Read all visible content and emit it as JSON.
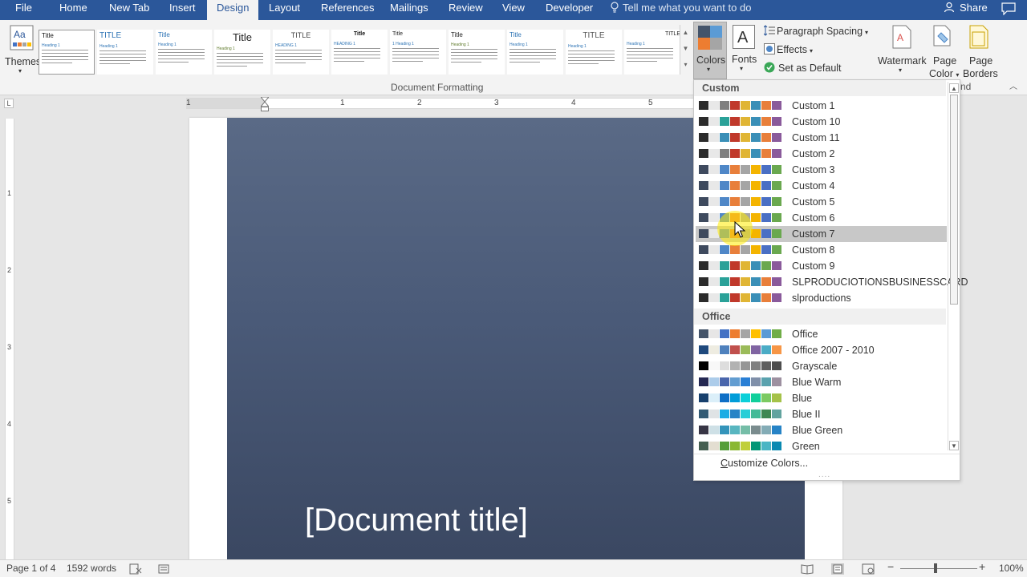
{
  "tabs": [
    "File",
    "Home",
    "New Tab",
    "Insert",
    "Design",
    "Layout",
    "References",
    "Mailings",
    "Review",
    "View",
    "Developer"
  ],
  "active_tab": "Design",
  "tell_me": "Tell me what you want to do",
  "share_label": "Share",
  "ribbon": {
    "themes_label": "Themes",
    "gallery_styles": [
      {
        "title": "Title",
        "heading": "Heading 1"
      },
      {
        "title": "TITLE",
        "heading": "Heading 1"
      },
      {
        "title": "Title",
        "heading": "Heading 1"
      },
      {
        "title": "Title",
        "heading": "Heading 1"
      },
      {
        "title": "TITLE",
        "heading": "HEADING 1"
      },
      {
        "title": "Title",
        "heading": "HEADING 1"
      },
      {
        "title": "Title",
        "heading": "1  Heading 1"
      },
      {
        "title": "Title",
        "heading": "Heading 1"
      },
      {
        "title": "Title",
        "heading": "Heading 1"
      },
      {
        "title": "TITLE",
        "heading": "Heading 1"
      },
      {
        "title": "TITLE",
        "heading": "Heading 1"
      }
    ],
    "document_formatting_label": "Document Formatting",
    "colors_label": "Colors",
    "fonts_label": "Fonts",
    "paragraph_spacing_label": "Paragraph Spacing",
    "effects_label": "Effects",
    "set_default_label": "Set as Default",
    "watermark_label": "Watermark",
    "page_color_label_1": "Page",
    "page_color_label_2": "Color",
    "page_borders_label_1": "Page",
    "page_borders_label_2": "Borders",
    "group_fragment": "nd"
  },
  "ruler": {
    "h_numbers": [
      "1",
      "1",
      "2",
      "3",
      "4",
      "5"
    ],
    "v_numbers": [
      "1",
      "2",
      "3",
      "4",
      "5"
    ]
  },
  "document": {
    "title_placeholder": "[Document title]"
  },
  "colors_dropdown": {
    "sections": [
      {
        "heading": "Custom",
        "schemes": [
          {
            "name": "Custom 1",
            "colors": [
              "#2b2b2b",
              "#e8e8e8",
              "#7f7f7f",
              "#c0392b",
              "#e0b534",
              "#3a8fb7",
              "#e87f3b",
              "#8a5a9b"
            ]
          },
          {
            "name": "Custom 10",
            "colors": [
              "#2b2b2b",
              "#e8e8e8",
              "#2aa198",
              "#c0392b",
              "#e0b534",
              "#3a8fb7",
              "#e87f3b",
              "#8a5a9b"
            ]
          },
          {
            "name": "Custom 11",
            "colors": [
              "#2b2b2b",
              "#e8e8e8",
              "#3a8fb7",
              "#c0392b",
              "#e0b534",
              "#3a8fb7",
              "#e87f3b",
              "#8a5a9b"
            ]
          },
          {
            "name": "Custom 2",
            "colors": [
              "#2b2b2b",
              "#e8e8e8",
              "#7f7f7f",
              "#c0392b",
              "#e0b534",
              "#3a8fb7",
              "#e87f3b",
              "#8a5a9b"
            ]
          },
          {
            "name": "Custom 3",
            "colors": [
              "#3e4a5e",
              "#e8e8e8",
              "#4f87c7",
              "#e87f3b",
              "#a5a5a5",
              "#f4b400",
              "#4a6fc4",
              "#6aa84f"
            ]
          },
          {
            "name": "Custom 4",
            "colors": [
              "#3e4a5e",
              "#e8e8e8",
              "#4f87c7",
              "#e87f3b",
              "#a5a5a5",
              "#f4b400",
              "#4a6fc4",
              "#6aa84f"
            ]
          },
          {
            "name": "Custom 5",
            "colors": [
              "#3e4a5e",
              "#e8e8e8",
              "#4f87c7",
              "#e87f3b",
              "#a5a5a5",
              "#f4b400",
              "#4a6fc4",
              "#6aa84f"
            ]
          },
          {
            "name": "Custom 6",
            "colors": [
              "#3e4a5e",
              "#e8e8e8",
              "#4f87c7",
              "#e87f3b",
              "#a5a5a5",
              "#f4b400",
              "#4a6fc4",
              "#6aa84f"
            ]
          },
          {
            "name": "Custom 7",
            "colors": [
              "#3e4a5e",
              "#e8e8e8",
              "#4f87c7",
              "#e87f3b",
              "#a5a5a5",
              "#f4b400",
              "#4a6fc4",
              "#6aa84f"
            ]
          },
          {
            "name": "Custom 8",
            "colors": [
              "#3e4a5e",
              "#e8e8e8",
              "#4f87c7",
              "#e87f3b",
              "#a5a5a5",
              "#f4b400",
              "#4a6fc4",
              "#6aa84f"
            ]
          },
          {
            "name": "Custom 9",
            "colors": [
              "#2b2b2b",
              "#e8e8e8",
              "#2aa198",
              "#c0392b",
              "#e0b534",
              "#3a8fb7",
              "#6aa84f",
              "#8a5a9b"
            ]
          },
          {
            "name": "SLPRODUCIOTIONSBUSINESSCARD",
            "colors": [
              "#2b2b2b",
              "#e8e8e8",
              "#2aa198",
              "#c0392b",
              "#e0b534",
              "#3a8fb7",
              "#e87f3b",
              "#8a5a9b"
            ]
          },
          {
            "name": "slproductions",
            "colors": [
              "#2b2b2b",
              "#e8e8e8",
              "#2aa198",
              "#c0392b",
              "#e0b534",
              "#3a8fb7",
              "#e87f3b",
              "#8a5a9b"
            ]
          }
        ]
      },
      {
        "heading": "Office",
        "schemes": [
          {
            "name": "Office",
            "colors": [
              "#44546a",
              "#e7e6e6",
              "#4472c4",
              "#ed7d31",
              "#a5a5a5",
              "#ffc000",
              "#5b9bd5",
              "#70ad47"
            ]
          },
          {
            "name": "Office 2007 - 2010",
            "colors": [
              "#1f497d",
              "#eeece1",
              "#4f81bd",
              "#c0504d",
              "#9bbb59",
              "#8064a2",
              "#4bacc6",
              "#f79646"
            ]
          },
          {
            "name": "Grayscale",
            "colors": [
              "#000000",
              "#f8f8f8",
              "#dddddd",
              "#b2b2b2",
              "#969696",
              "#808080",
              "#5f5f5f",
              "#4d4d4d"
            ]
          },
          {
            "name": "Blue Warm",
            "colors": [
              "#242852",
              "#acccea",
              "#4a66ac",
              "#629dd1",
              "#297fd5",
              "#7f8fa9",
              "#5aa2ae",
              "#9d90a0"
            ]
          },
          {
            "name": "Blue",
            "colors": [
              "#17406d",
              "#dbeff9",
              "#0f6fc6",
              "#009dd9",
              "#0bd0d9",
              "#10cf9b",
              "#7cca62",
              "#a5c249"
            ]
          },
          {
            "name": "Blue II",
            "colors": [
              "#335b74",
              "#dfe3e5",
              "#1cade4",
              "#2683c6",
              "#27ced7",
              "#42ba97",
              "#3e8853",
              "#62a39f"
            ]
          },
          {
            "name": "Blue Green",
            "colors": [
              "#373545",
              "#cee0e6",
              "#3494ba",
              "#58b6c0",
              "#75bda7",
              "#7a8c8e",
              "#84acb6",
              "#2683c6"
            ]
          },
          {
            "name": "Green",
            "colors": [
              "#455f51",
              "#e3ded1",
              "#549e39",
              "#8ab833",
              "#c0cf3a",
              "#029676",
              "#4ab5c4",
              "#0989b1"
            ]
          }
        ]
      }
    ],
    "hovered": "Custom 7",
    "customize_prefix": "C",
    "customize_rest": "ustomize Colors..."
  },
  "status_bar": {
    "page": "Page 1 of 4",
    "words": "1592 words",
    "zoom": "100%"
  }
}
